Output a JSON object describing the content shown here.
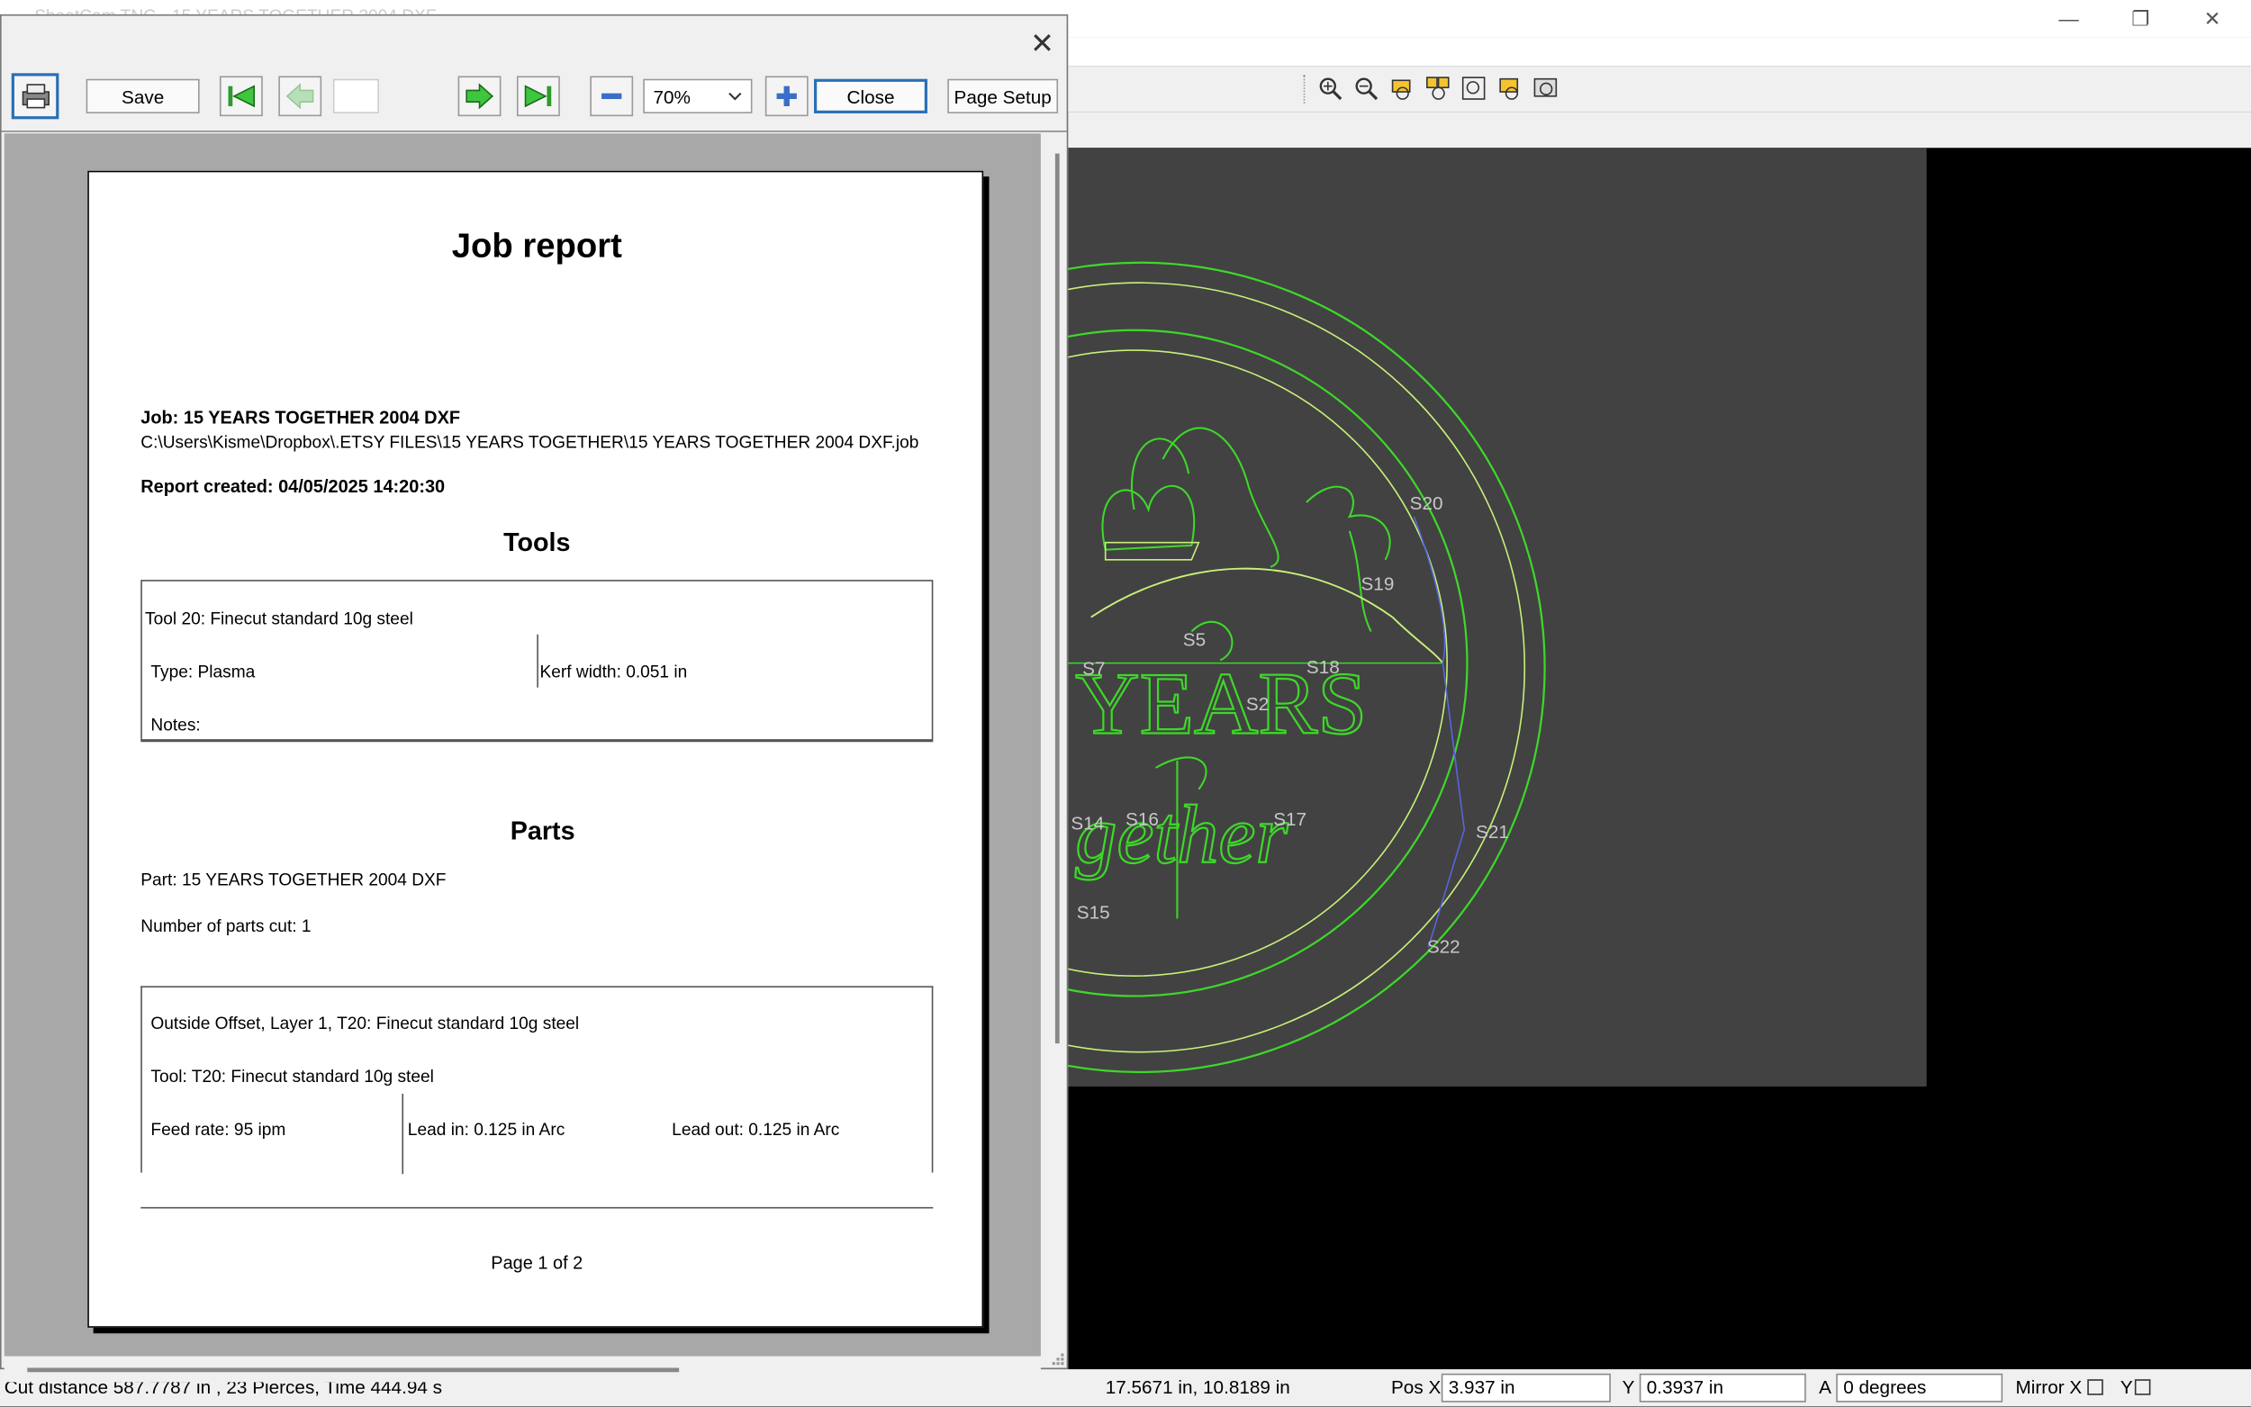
{
  "app": {
    "title": "SheetCam TNG - 15 YEARS TOGETHER 2004 DXF",
    "window_controls": {
      "minimize": "—",
      "maximize": "❐",
      "close": "✕"
    }
  },
  "preview": {
    "toolbar": {
      "save_label": "Save",
      "page_input": "",
      "zoom_value": "70%",
      "close_label": "Close",
      "page_setup_label": "Page Setup"
    },
    "dialog_close": "✕",
    "report": {
      "title": "Job report",
      "job_line": "Job: 15 YEARS TOGETHER 2004 DXF",
      "job_path": "C:\\Users\\Kisme\\Dropbox\\.ETSY FILES\\15 YEARS TOGETHER\\15 YEARS TOGETHER 2004 DXF.job",
      "report_created": "Report created: 04/05/2025 14:20:30",
      "tools_heading": "Tools",
      "tool_name": "Tool 20: Finecut standard 10g steel",
      "tool_type": "Type: Plasma",
      "kerf": "Kerf width: 0.051 in",
      "notes": "Notes:",
      "parts_heading": "Parts",
      "part_line": "Part: 15 YEARS TOGETHER 2004 DXF",
      "parts_cut": "Number of parts cut: 1",
      "op_line": "Outside Offset, Layer 1, T20: Finecut standard 10g steel",
      "op_tool": "Tool: T20: Finecut standard 10g steel",
      "feed": "Feed rate: 95 ipm",
      "lead_in": "Lead in: 0.125 in Arc",
      "lead_out": "Lead out: 0.125 in Arc",
      "page_footer": "Page 1 of 2"
    }
  },
  "canvas": {
    "art_text_1": "YEARS",
    "art_text_2": "gether",
    "labels": [
      "S20",
      "S19",
      "S18",
      "S5",
      "S7",
      "S2",
      "S21",
      "S17",
      "S16",
      "S14",
      "S15",
      "S22"
    ]
  },
  "status": {
    "cut_info": "Cut distance 587.7787 in , 23 Pierces, Time 444.94 s",
    "cursor_pos": "17.5671 in, 10.8189 in",
    "pos_x_label": "Pos X",
    "pos_x_value": "3.937 in",
    "y_label": "Y",
    "y_value": "0.3937 in",
    "a_label": "A",
    "a_value": "0 degrees",
    "mirror_x_label": "Mirror X",
    "mirror_y_label": "Y"
  },
  "colors": {
    "toolpath": "#3ed72a",
    "path_outline": "#c8f07a",
    "rapid": "#5566dd",
    "canvas": "#424242"
  }
}
